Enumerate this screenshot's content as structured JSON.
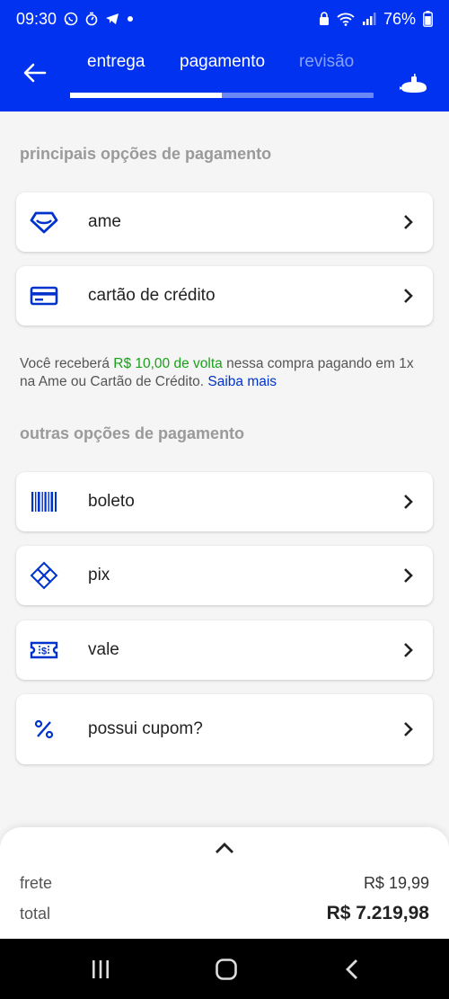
{
  "status_bar": {
    "time": "09:30",
    "battery": "76%"
  },
  "header": {
    "steps": [
      "entrega",
      "pagamento",
      "revisão"
    ],
    "progress": 0.5,
    "colors": {
      "brand": "#0032f0",
      "active": "#ffffff",
      "inactive": "#8aa2f5"
    }
  },
  "main_options": {
    "title": "principais opções de pagamento",
    "items": [
      {
        "label": "ame",
        "icon": "ame-heart-icon"
      },
      {
        "label": "cartão de crédito",
        "icon": "credit-card-icon"
      }
    ]
  },
  "cashback": {
    "prefix": "Você receberá ",
    "highlight": "R$ 10,00 de volta",
    "suffix": " nessa compra pagando em 1x na Ame ou Cartão de Crédito. ",
    "link": "Saiba mais",
    "highlight_color": "#1aa01a"
  },
  "other_options": {
    "title": "outras opções de pagamento",
    "items": [
      {
        "label": "boleto",
        "icon": "barcode-icon"
      },
      {
        "label": "pix",
        "icon": "pix-icon"
      },
      {
        "label": "vale",
        "icon": "voucher-icon"
      },
      {
        "label": "possui cupom?",
        "icon": "percent-icon"
      }
    ]
  },
  "summary": {
    "frete_label": "frete",
    "frete_value": "R$ 19,99",
    "total_label": "total",
    "total_value": "R$ 7.219,98"
  }
}
